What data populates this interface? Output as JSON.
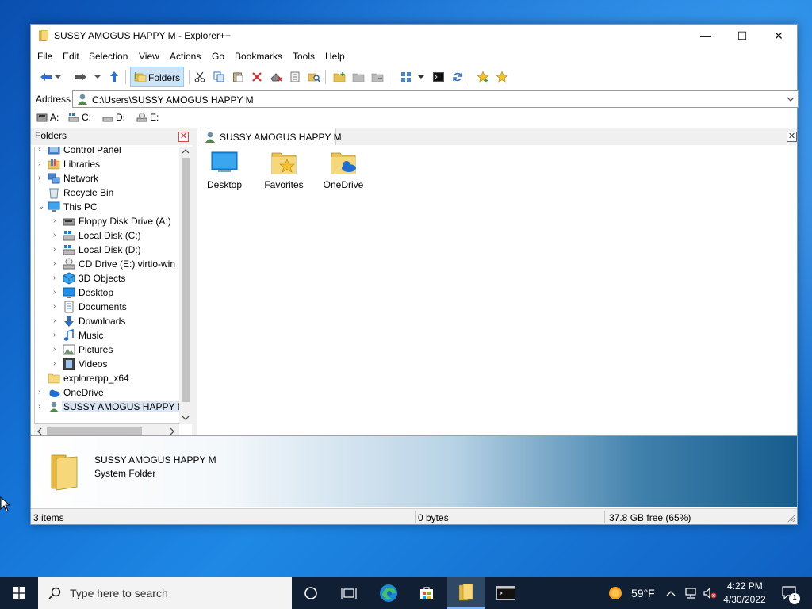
{
  "window": {
    "title": "SUSSY AMOGUS HAPPY M - Explorer++",
    "minimize_glyph": "—",
    "maximize_glyph": "☐",
    "close_glyph": "✕"
  },
  "menu": {
    "items": [
      "File",
      "Edit",
      "Selection",
      "View",
      "Actions",
      "Go",
      "Bookmarks",
      "Tools",
      "Help"
    ]
  },
  "toolbar": {
    "folders_label": "Folders",
    "icons": [
      "back-arrow-icon",
      "forward-arrow-icon",
      "up-arrow-icon",
      "cut-icon",
      "copy-icon",
      "paste-icon",
      "delete-icon",
      "delete-permanently-icon",
      "properties-icon",
      "search-icon",
      "new-folder-icon",
      "copy-to-icon",
      "move-to-icon",
      "views-icon",
      "command-prompt-icon",
      "refresh-icon",
      "add-bookmark-icon",
      "bookmarks-icon"
    ]
  },
  "address": {
    "label": "Address",
    "value": "C:\\Users\\SUSSY AMOGUS HAPPY M"
  },
  "drives": [
    {
      "label": "A:",
      "icon": "floppy-drive-icon"
    },
    {
      "label": "C:",
      "icon": "local-disk-icon"
    },
    {
      "label": "D:",
      "icon": "local-disk-icon"
    },
    {
      "label": "E:",
      "icon": "cd-drive-icon"
    }
  ],
  "folders_pane": {
    "title": "Folders",
    "close_glyph": "✕",
    "tree": [
      {
        "label": "Control Panel",
        "icon": "control-panel-icon",
        "level": 0,
        "expander": "›"
      },
      {
        "label": "Libraries",
        "icon": "libraries-icon",
        "level": 0,
        "expander": "›"
      },
      {
        "label": "Network",
        "icon": "network-icon",
        "level": 0,
        "expander": "›"
      },
      {
        "label": "Recycle Bin",
        "icon": "recycle-bin-icon",
        "level": 0,
        "expander": ""
      },
      {
        "label": "This PC",
        "icon": "this-pc-icon",
        "level": 0,
        "expander": "⌄"
      },
      {
        "label": "Floppy Disk Drive (A:)",
        "icon": "floppy-drive-icon",
        "level": 1,
        "expander": "›"
      },
      {
        "label": "Local Disk (C:)",
        "icon": "local-disk-icon",
        "level": 1,
        "expander": "›"
      },
      {
        "label": "Local Disk (D:)",
        "icon": "local-disk-icon",
        "level": 1,
        "expander": "›"
      },
      {
        "label": "CD Drive (E:) virtio-win",
        "icon": "cd-drive-icon",
        "level": 1,
        "expander": "›"
      },
      {
        "label": "3D Objects",
        "icon": "3d-objects-icon",
        "level": 1,
        "expander": "›"
      },
      {
        "label": "Desktop",
        "icon": "desktop-icon",
        "level": 1,
        "expander": "›"
      },
      {
        "label": "Documents",
        "icon": "documents-icon",
        "level": 1,
        "expander": "›"
      },
      {
        "label": "Downloads",
        "icon": "downloads-icon",
        "level": 1,
        "expander": "›"
      },
      {
        "label": "Music",
        "icon": "music-icon",
        "level": 1,
        "expander": "›"
      },
      {
        "label": "Pictures",
        "icon": "pictures-icon",
        "level": 1,
        "expander": "›"
      },
      {
        "label": "Videos",
        "icon": "videos-icon",
        "level": 1,
        "expander": "›"
      },
      {
        "label": "explorerpp_x64",
        "icon": "folder-icon",
        "level": 0,
        "expander": ""
      },
      {
        "label": "OneDrive",
        "icon": "onedrive-icon",
        "level": 0,
        "expander": "›"
      },
      {
        "label": "SUSSY AMOGUS HAPPY M",
        "icon": "user-icon",
        "level": 0,
        "expander": "›",
        "selected": true
      }
    ]
  },
  "tab": {
    "label": "SUSSY AMOGUS HAPPY M",
    "close_glyph": "✕"
  },
  "files": [
    {
      "label": "Desktop",
      "icon": "desktop-folder-icon"
    },
    {
      "label": "Favorites",
      "icon": "favorites-folder-icon"
    },
    {
      "label": "OneDrive",
      "icon": "onedrive-folder-icon"
    }
  ],
  "info": {
    "name": "SUSSY AMOGUS HAPPY M",
    "type": "System Folder"
  },
  "status": {
    "items": "3 items",
    "size": "0 bytes",
    "free": "37.8 GB free (65%)"
  },
  "taskbar": {
    "search_placeholder": "Type here to search",
    "weather": "59°F",
    "time": "4:22 PM",
    "date": "4/30/2022",
    "notification_count": "1"
  },
  "colors": {
    "accent": "#0078d7",
    "selection": "#cce4f7",
    "taskbar": "#101f33"
  }
}
